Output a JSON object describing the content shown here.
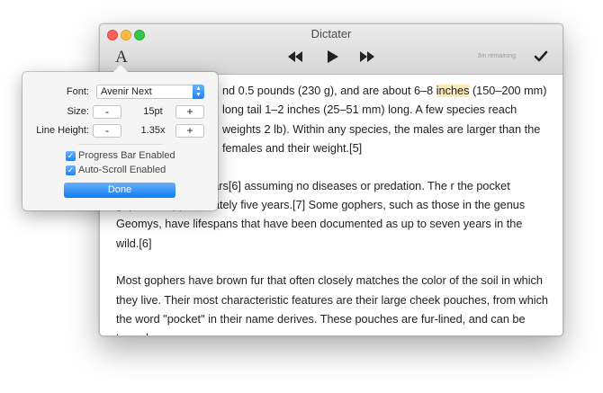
{
  "window": {
    "title": "Dictater",
    "font_button": "A",
    "remaining": "3m remaining"
  },
  "content": {
    "paragraphs": [
      {
        "text_before": "nd 0.5 pounds (230 g), and are about 6–8 ",
        "highlight": "inches",
        "text_after": " (150–200 mm) long tail 1–2 inches (25–51 mm) long. A few species reach weights 2 lb). Within any species, the males are larger than the females and their weight.[5]"
      },
      {
        "text": "ally one to three years[6] assuming no diseases or predation. The r the pocket gopher is approximately five years.[7] Some gophers, such as those in the genus Geomys, have lifespans that have been documented as up to seven years in the wild.[6]"
      },
      {
        "text": "Most gophers have brown fur that often closely matches the color of the soil in which they live. Their most characteristic features are their large cheek pouches, from which the word \"pocket\" in their name derives. These pouches are fur-lined, and can be turned"
      }
    ],
    "highlight_color": "#fbe7b7"
  },
  "popover": {
    "font_label": "Font:",
    "font_value": "Avenir Next",
    "size_label": "Size:",
    "size_value": "15pt",
    "line_height_label": "Line Height:",
    "line_height_value": "1.35x",
    "minus": "-",
    "plus": "+",
    "progress_bar_label": "Progress Bar Enabled",
    "progress_bar_checked": true,
    "auto_scroll_label": "Auto-Scroll Enabled",
    "auto_scroll_checked": true,
    "done_label": "Done",
    "accent_color": "#1a82fb"
  }
}
